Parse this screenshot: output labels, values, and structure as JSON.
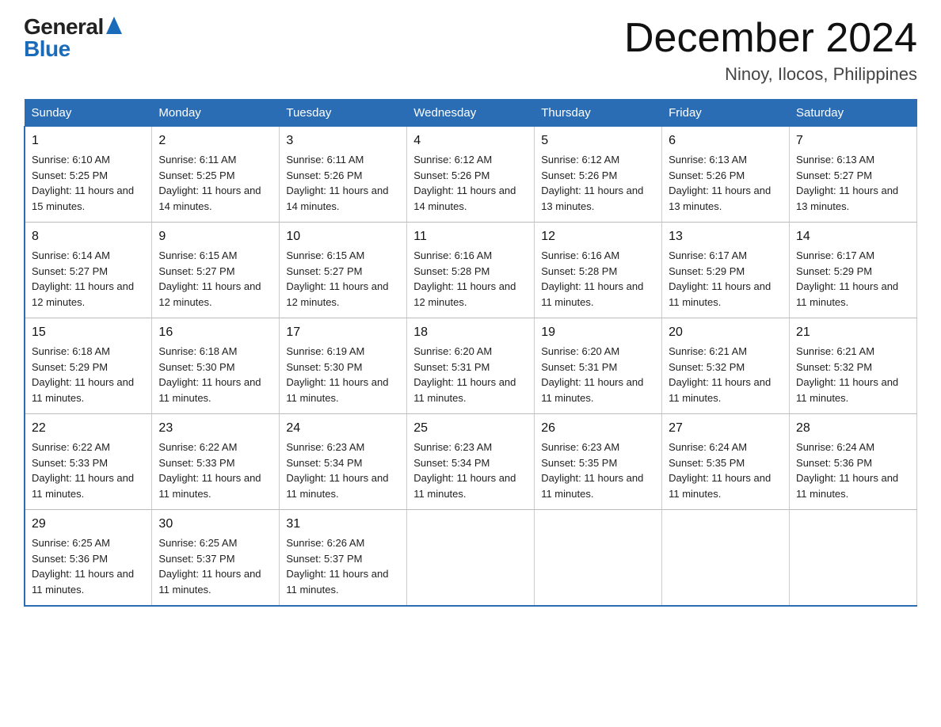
{
  "logo": {
    "general": "General",
    "blue": "Blue"
  },
  "title": {
    "month_year": "December 2024",
    "location": "Ninoy, Ilocos, Philippines"
  },
  "weekdays": [
    "Sunday",
    "Monday",
    "Tuesday",
    "Wednesday",
    "Thursday",
    "Friday",
    "Saturday"
  ],
  "weeks": [
    [
      {
        "day": "1",
        "sunrise": "6:10 AM",
        "sunset": "5:25 PM",
        "daylight": "11 hours and 15 minutes."
      },
      {
        "day": "2",
        "sunrise": "6:11 AM",
        "sunset": "5:25 PM",
        "daylight": "11 hours and 14 minutes."
      },
      {
        "day": "3",
        "sunrise": "6:11 AM",
        "sunset": "5:26 PM",
        "daylight": "11 hours and 14 minutes."
      },
      {
        "day": "4",
        "sunrise": "6:12 AM",
        "sunset": "5:26 PM",
        "daylight": "11 hours and 14 minutes."
      },
      {
        "day": "5",
        "sunrise": "6:12 AM",
        "sunset": "5:26 PM",
        "daylight": "11 hours and 13 minutes."
      },
      {
        "day": "6",
        "sunrise": "6:13 AM",
        "sunset": "5:26 PM",
        "daylight": "11 hours and 13 minutes."
      },
      {
        "day": "7",
        "sunrise": "6:13 AM",
        "sunset": "5:27 PM",
        "daylight": "11 hours and 13 minutes."
      }
    ],
    [
      {
        "day": "8",
        "sunrise": "6:14 AM",
        "sunset": "5:27 PM",
        "daylight": "11 hours and 12 minutes."
      },
      {
        "day": "9",
        "sunrise": "6:15 AM",
        "sunset": "5:27 PM",
        "daylight": "11 hours and 12 minutes."
      },
      {
        "day": "10",
        "sunrise": "6:15 AM",
        "sunset": "5:27 PM",
        "daylight": "11 hours and 12 minutes."
      },
      {
        "day": "11",
        "sunrise": "6:16 AM",
        "sunset": "5:28 PM",
        "daylight": "11 hours and 12 minutes."
      },
      {
        "day": "12",
        "sunrise": "6:16 AM",
        "sunset": "5:28 PM",
        "daylight": "11 hours and 11 minutes."
      },
      {
        "day": "13",
        "sunrise": "6:17 AM",
        "sunset": "5:29 PM",
        "daylight": "11 hours and 11 minutes."
      },
      {
        "day": "14",
        "sunrise": "6:17 AM",
        "sunset": "5:29 PM",
        "daylight": "11 hours and 11 minutes."
      }
    ],
    [
      {
        "day": "15",
        "sunrise": "6:18 AM",
        "sunset": "5:29 PM",
        "daylight": "11 hours and 11 minutes."
      },
      {
        "day": "16",
        "sunrise": "6:18 AM",
        "sunset": "5:30 PM",
        "daylight": "11 hours and 11 minutes."
      },
      {
        "day": "17",
        "sunrise": "6:19 AM",
        "sunset": "5:30 PM",
        "daylight": "11 hours and 11 minutes."
      },
      {
        "day": "18",
        "sunrise": "6:20 AM",
        "sunset": "5:31 PM",
        "daylight": "11 hours and 11 minutes."
      },
      {
        "day": "19",
        "sunrise": "6:20 AM",
        "sunset": "5:31 PM",
        "daylight": "11 hours and 11 minutes."
      },
      {
        "day": "20",
        "sunrise": "6:21 AM",
        "sunset": "5:32 PM",
        "daylight": "11 hours and 11 minutes."
      },
      {
        "day": "21",
        "sunrise": "6:21 AM",
        "sunset": "5:32 PM",
        "daylight": "11 hours and 11 minutes."
      }
    ],
    [
      {
        "day": "22",
        "sunrise": "6:22 AM",
        "sunset": "5:33 PM",
        "daylight": "11 hours and 11 minutes."
      },
      {
        "day": "23",
        "sunrise": "6:22 AM",
        "sunset": "5:33 PM",
        "daylight": "11 hours and 11 minutes."
      },
      {
        "day": "24",
        "sunrise": "6:23 AM",
        "sunset": "5:34 PM",
        "daylight": "11 hours and 11 minutes."
      },
      {
        "day": "25",
        "sunrise": "6:23 AM",
        "sunset": "5:34 PM",
        "daylight": "11 hours and 11 minutes."
      },
      {
        "day": "26",
        "sunrise": "6:23 AM",
        "sunset": "5:35 PM",
        "daylight": "11 hours and 11 minutes."
      },
      {
        "day": "27",
        "sunrise": "6:24 AM",
        "sunset": "5:35 PM",
        "daylight": "11 hours and 11 minutes."
      },
      {
        "day": "28",
        "sunrise": "6:24 AM",
        "sunset": "5:36 PM",
        "daylight": "11 hours and 11 minutes."
      }
    ],
    [
      {
        "day": "29",
        "sunrise": "6:25 AM",
        "sunset": "5:36 PM",
        "daylight": "11 hours and 11 minutes."
      },
      {
        "day": "30",
        "sunrise": "6:25 AM",
        "sunset": "5:37 PM",
        "daylight": "11 hours and 11 minutes."
      },
      {
        "day": "31",
        "sunrise": "6:26 AM",
        "sunset": "5:37 PM",
        "daylight": "11 hours and 11 minutes."
      },
      {
        "day": "",
        "sunrise": "",
        "sunset": "",
        "daylight": ""
      },
      {
        "day": "",
        "sunrise": "",
        "sunset": "",
        "daylight": ""
      },
      {
        "day": "",
        "sunrise": "",
        "sunset": "",
        "daylight": ""
      },
      {
        "day": "",
        "sunrise": "",
        "sunset": "",
        "daylight": ""
      }
    ]
  ],
  "labels": {
    "sunrise": "Sunrise: ",
    "sunset": "Sunset: ",
    "daylight": "Daylight: "
  }
}
